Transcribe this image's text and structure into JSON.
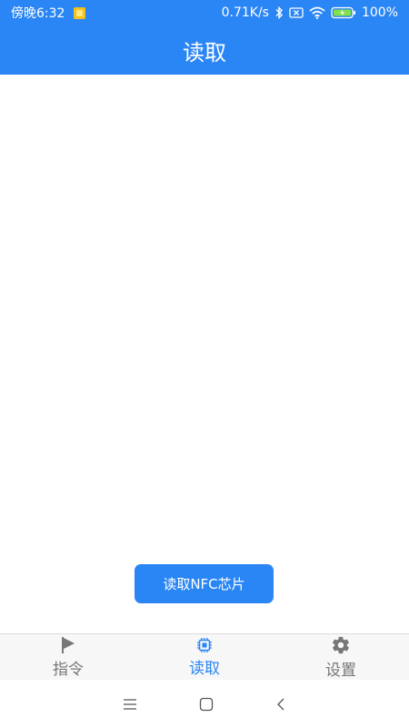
{
  "status_bar": {
    "time": "傍晚6:32",
    "net_speed": "0.71K/s",
    "battery": "100%",
    "icons": [
      "notification-icon",
      "bluetooth-icon",
      "no-sim-icon",
      "wifi-icon",
      "battery-charging-icon"
    ]
  },
  "app_bar": {
    "title": "读取"
  },
  "main": {
    "read_button_label": "读取NFC芯片"
  },
  "bottom_nav": {
    "items": [
      {
        "label": "指令",
        "icon": "flag-icon",
        "active": false
      },
      {
        "label": "读取",
        "icon": "chip-icon",
        "active": true
      },
      {
        "label": "设置",
        "icon": "gear-icon",
        "active": false
      }
    ]
  },
  "system_nav": {
    "icons": [
      "menu-icon",
      "home-icon",
      "back-icon"
    ]
  },
  "colors": {
    "primary": "#2b86f5",
    "inactive": "#777777",
    "nav_background": "#f7f7f7"
  }
}
